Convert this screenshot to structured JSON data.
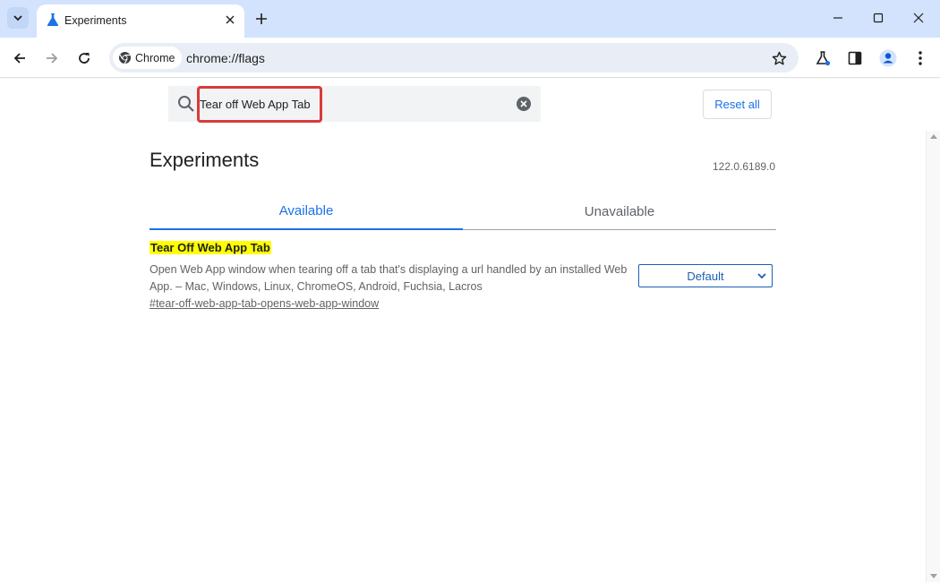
{
  "browser": {
    "tab": {
      "title": "Experiments",
      "favicon": "flask-icon"
    },
    "window_controls": [
      "minimize-icon",
      "maximize-icon",
      "close-icon"
    ]
  },
  "toolbar": {
    "chip_label": "Chrome",
    "url": "chrome://flags"
  },
  "flags_header": {
    "search_value": "Tear off Web App Tab",
    "reset_label": "Reset all"
  },
  "content": {
    "title": "Experiments",
    "version": "122.0.6189.0",
    "tabs": [
      {
        "label": "Available",
        "active": true
      },
      {
        "label": "Unavailable",
        "active": false
      }
    ],
    "flag": {
      "name": "Tear Off Web App Tab",
      "description": "Open Web App window when tearing off a tab that's displaying a url handled by an installed Web App. – Mac, Windows, Linux, ChromeOS, Android, Fuchsia, Lacros",
      "link": "#tear-off-web-app-tab-opens-web-app-window",
      "selected": "Default"
    }
  },
  "colors": {
    "tabstrip": "#d3e3fd",
    "accent": "#1a73e8",
    "highlight": "#ffff00",
    "annotation_box": "#d93a3a"
  }
}
